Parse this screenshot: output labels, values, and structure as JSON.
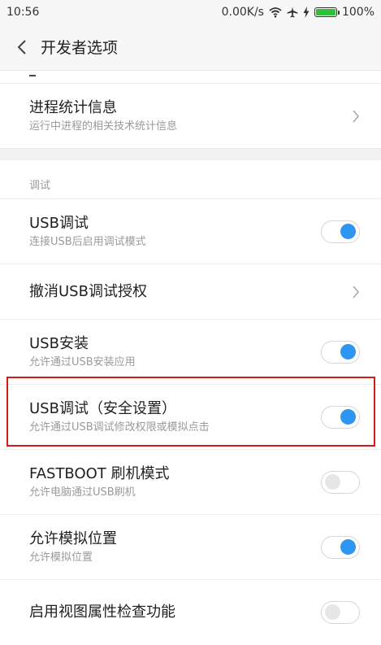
{
  "status_bar": {
    "time": "10:56",
    "speed": "0.00K/s",
    "battery": "100%",
    "icons": [
      "wifi-icon",
      "airplane-icon",
      "charging-icon",
      "battery-icon"
    ]
  },
  "header": {
    "title": "开发者选项"
  },
  "items_top": [
    {
      "label": "进程统计信息",
      "summary": "运行中进程的相关技术统计信息",
      "control": "chevron"
    }
  ],
  "section": {
    "title": "调试"
  },
  "items_debug": [
    {
      "label": "USB调试",
      "summary": "连接USB后启用调试模式",
      "control": "toggle",
      "on": true
    },
    {
      "label": "撤消USB调试授权",
      "summary": "",
      "control": "chevron"
    },
    {
      "label": "USB安装",
      "summary": "允许通过USB安装应用",
      "control": "toggle",
      "on": true
    },
    {
      "label": "USB调试（安全设置）",
      "summary": "允许通过USB调试修改权限或模拟点击",
      "control": "toggle",
      "on": true
    },
    {
      "label": "FASTBOOT 刷机模式",
      "summary": "允许电脑通过USB刷机",
      "control": "toggle",
      "on": false
    },
    {
      "label": "允许模拟位置",
      "summary": "允许模拟位置",
      "control": "toggle",
      "on": true
    },
    {
      "label": "启用视图属性检查功能",
      "summary": "",
      "control": "toggle",
      "on": false
    }
  ],
  "colors": {
    "accent": "#2e95f0",
    "highlight": "#d11a1a"
  }
}
